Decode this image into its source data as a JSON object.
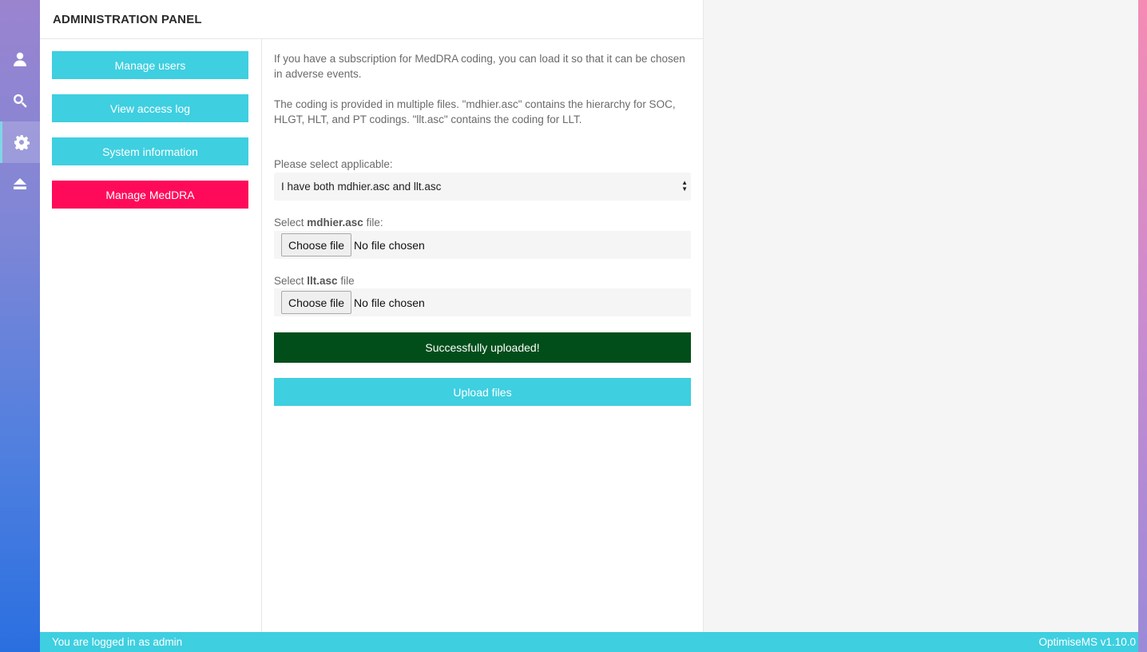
{
  "rail": {
    "items": [
      {
        "icon": "user-icon"
      },
      {
        "icon": "search-icon"
      },
      {
        "icon": "gear-icon"
      },
      {
        "icon": "eject-icon"
      }
    ],
    "active_index": 2
  },
  "panel": {
    "title": "ADMINISTRATION PANEL",
    "menu": [
      {
        "label": "Manage users",
        "color": "#3ecfe0"
      },
      {
        "label": "View access log",
        "color": "#3ecfe0"
      },
      {
        "label": "System information",
        "color": "#3ecfe0"
      },
      {
        "label": "Manage MedDRA",
        "color": "#ff0a5a",
        "active": true
      }
    ]
  },
  "content": {
    "intro": "If you have a subscription for MedDRA coding, you can load it so that it can be chosen in adverse events.",
    "coding_note": "The coding is provided in multiple files. \"mdhier.asc\" contains the hierarchy for SOC, HLGT, HLT, and PT codings. \"llt.asc\" contains the coding for LLT.",
    "select_label": "Please select applicable:",
    "select_value": "I have both mdhier.asc and llt.asc",
    "file1": {
      "prefix": "Select ",
      "name": "mdhier.asc",
      "suffix": " file:",
      "button": "Choose file",
      "status": "No file chosen"
    },
    "file2": {
      "prefix": "Select ",
      "name": "llt.asc",
      "suffix": " file",
      "button": "Choose file",
      "status": "No file chosen"
    },
    "success_message": "Successfully uploaded!",
    "upload_label": "Upload files"
  },
  "footer": {
    "login_text": "You are logged in as admin",
    "version": "OptimiseMS v1.10.0"
  },
  "colors": {
    "accent": "#3ecfe0",
    "danger": "#ff0a5a",
    "success": "#024e1a"
  }
}
